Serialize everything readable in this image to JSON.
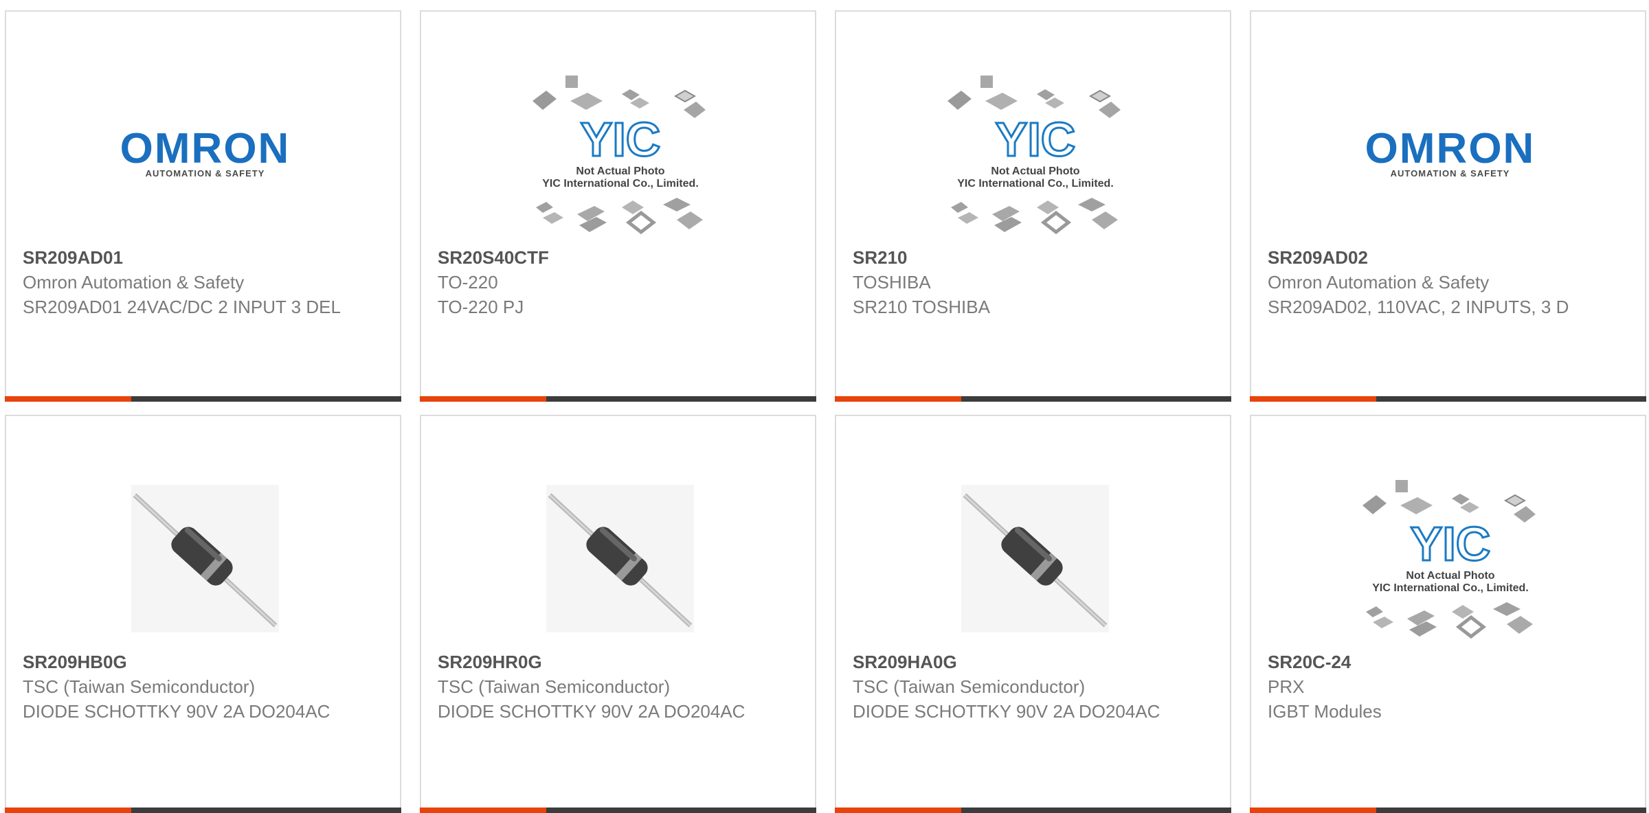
{
  "colors": {
    "accent_red": "#e8420d",
    "accent_dark": "#3c3c3c",
    "omron_blue": "#1a6fbf"
  },
  "placeholder": {
    "brand": "YIC",
    "line1": "Not Actual Photo",
    "line2": "YIC International Co., Limited."
  },
  "omron_logo": {
    "name": "OMRON",
    "tagline": "AUTOMATION & SAFETY"
  },
  "products": [
    {
      "part": "SR209AD01",
      "manufacturer": "Omron Automation & Safety",
      "description": "SR209AD01 24VAC/DC 2 INPUT 3 DEL",
      "image": "omron-logo"
    },
    {
      "part": "SR20S40CTF",
      "manufacturer": "TO-220",
      "description": "TO-220 PJ",
      "image": "yic-placeholder"
    },
    {
      "part": "SR210",
      "manufacturer": "TOSHIBA",
      "description": "SR210 TOSHIBA",
      "image": "yic-placeholder"
    },
    {
      "part": "SR209AD02",
      "manufacturer": "Omron Automation & Safety",
      "description": "SR209AD02, 110VAC, 2 INPUTS, 3 D",
      "image": "omron-logo"
    },
    {
      "part": "SR209HB0G",
      "manufacturer": "TSC (Taiwan Semiconductor)",
      "description": "DIODE SCHOTTKY 90V 2A DO204AC",
      "image": "diode-photo"
    },
    {
      "part": "SR209HR0G",
      "manufacturer": "TSC (Taiwan Semiconductor)",
      "description": "DIODE SCHOTTKY 90V 2A DO204AC",
      "image": "diode-photo"
    },
    {
      "part": "SR209HA0G",
      "manufacturer": "TSC (Taiwan Semiconductor)",
      "description": "DIODE SCHOTTKY 90V 2A DO204AC",
      "image": "diode-photo"
    },
    {
      "part": "SR20C-24",
      "manufacturer": "PRX",
      "description": "IGBT Modules",
      "image": "yic-placeholder"
    }
  ]
}
